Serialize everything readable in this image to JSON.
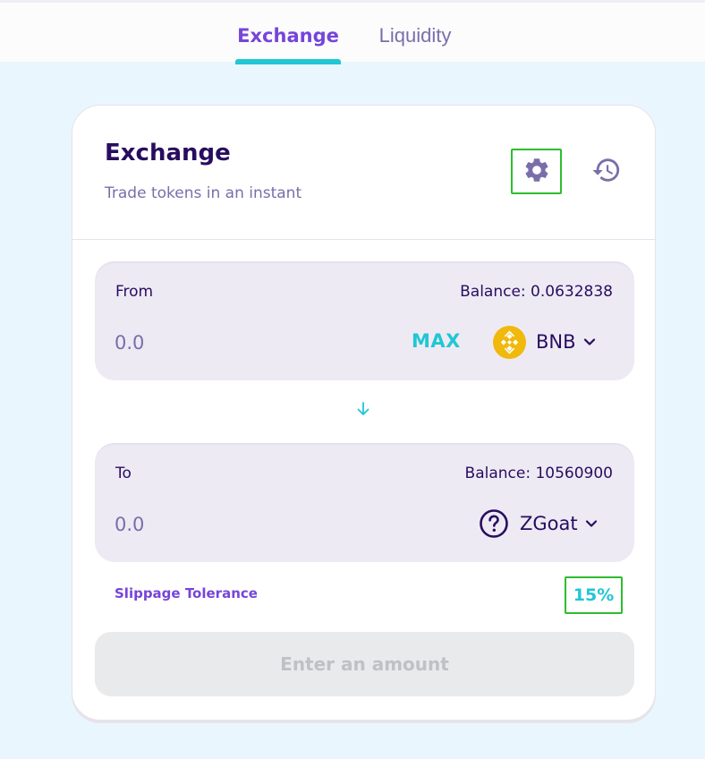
{
  "nav": {
    "tabs": [
      {
        "label": "Exchange",
        "active": true
      },
      {
        "label": "Liquidity",
        "active": false
      }
    ]
  },
  "card": {
    "title": "Exchange",
    "subtitle": "Trade tokens in an instant",
    "icons": {
      "settings": "gear-icon",
      "history": "history-icon"
    }
  },
  "from": {
    "label": "From",
    "balance": "Balance: 0.0632838",
    "placeholder": "0.0",
    "max_label": "MAX",
    "token": "BNB",
    "token_icon": "bnb-icon"
  },
  "to": {
    "label": "To",
    "balance": "Balance: 10560900",
    "placeholder": "0.0",
    "token": "ZGoat",
    "token_icon": "question-circle-icon"
  },
  "slippage": {
    "label": "Slippage Tolerance",
    "value": "15%"
  },
  "submit": {
    "label": "Enter an amount"
  },
  "colors": {
    "primary": "#7645d9",
    "secondary": "#1fc7d4",
    "text": "#280d5f",
    "text_subtle": "#7a6eaa",
    "bnb": "#f0b90b"
  }
}
